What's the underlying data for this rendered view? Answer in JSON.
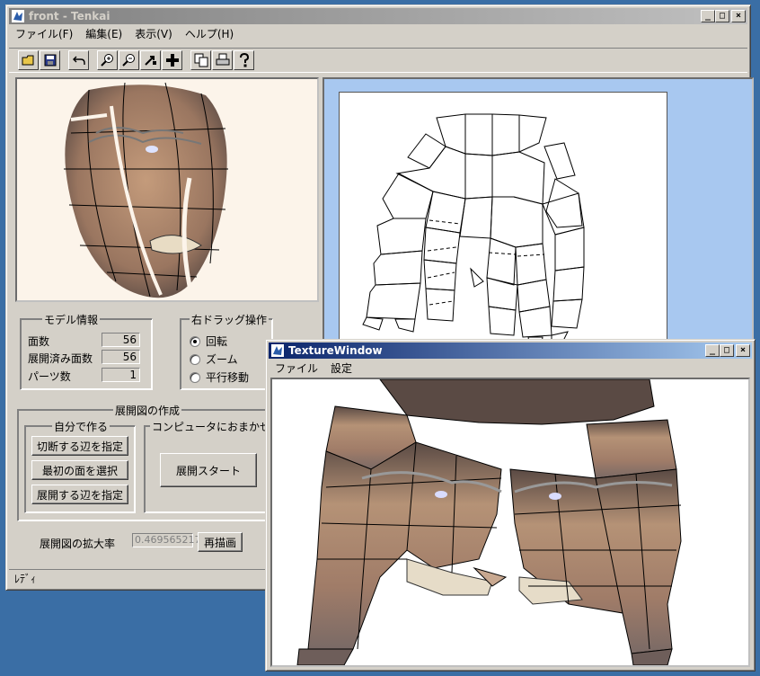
{
  "main_window": {
    "title": "front - Tenkai",
    "menu": [
      "ファイル(F)",
      "編集(E)",
      "表示(V)",
      "ヘルプ(H)"
    ],
    "toolbar_icons": [
      "open-icon",
      "save-icon",
      "undo-icon",
      "zoom-in-icon",
      "zoom-out-icon",
      "move-icon",
      "grid-icon",
      "copy-icon",
      "print-icon",
      "help-icon"
    ],
    "window_buttons": {
      "minimize": "_",
      "maximize": "□",
      "close": "×"
    },
    "status": "ﾚﾃﾞｨ"
  },
  "model_info": {
    "group_label": "モデル情報",
    "rows": [
      {
        "label": "面数",
        "value": "56"
      },
      {
        "label": "展開済み面数",
        "value": "56"
      },
      {
        "label": "パーツ数",
        "value": "1"
      }
    ]
  },
  "right_drag": {
    "group_label": "右ドラッグ操作",
    "options": [
      {
        "label": "回転",
        "checked": true
      },
      {
        "label": "ズーム",
        "checked": false
      },
      {
        "label": "平行移動",
        "checked": false
      }
    ]
  },
  "unfold": {
    "group_label": "展開図の作成",
    "manual": {
      "group_label": "自分で作る",
      "buttons": [
        "切断する辺を指定",
        "最初の面を選択",
        "展開する辺を指定"
      ]
    },
    "auto": {
      "group_label": "コンピュータにおまかせ",
      "button": "展開スタート"
    }
  },
  "zoom": {
    "label": "展開図の拡大率",
    "value": "0.469565217",
    "redraw_button": "再描画"
  },
  "texture_window": {
    "title": "TextureWindow",
    "menu": [
      "ファイル",
      "設定"
    ],
    "window_buttons": {
      "minimize": "_",
      "maximize": "□",
      "close": "×"
    }
  },
  "colors": {
    "desktop": "#3a6ea5",
    "active_title": "#0a246a",
    "inactive_title": "#808080",
    "view2d_bg": "#a8c8f0",
    "view3d_bg": "#fcf4ea",
    "skin": "#b08a6c"
  }
}
